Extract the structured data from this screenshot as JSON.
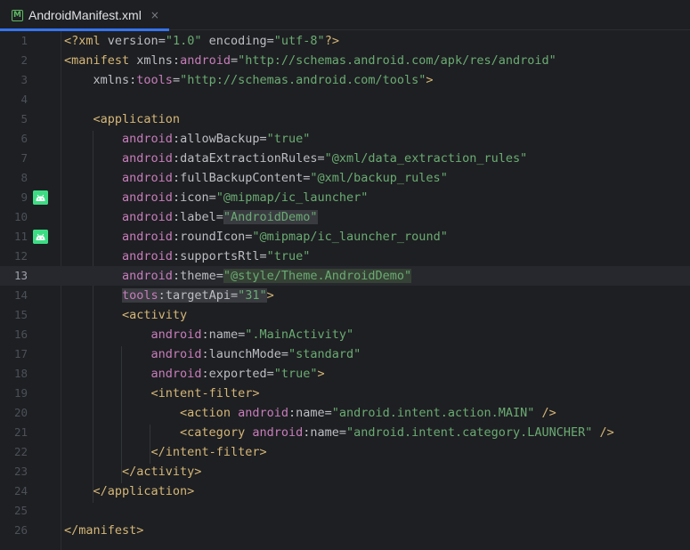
{
  "tab": {
    "title": "AndroidManifest.xml",
    "icon_glyph": "M",
    "close_glyph": "×"
  },
  "editor": {
    "current_line": 13,
    "lines": [
      {
        "n": "1",
        "tokens": [
          {
            "t": "<?xml ",
            "c": "t-tag"
          },
          {
            "t": "version",
            "c": "t-attr"
          },
          {
            "t": "=",
            "c": "t-txt"
          },
          {
            "t": "\"1.0\"",
            "c": "t-val"
          },
          {
            "t": " ",
            "c": "t-txt"
          },
          {
            "t": "encoding",
            "c": "t-attr"
          },
          {
            "t": "=",
            "c": "t-txt"
          },
          {
            "t": "\"utf-8\"",
            "c": "t-val"
          },
          {
            "t": "?>",
            "c": "t-tag"
          }
        ]
      },
      {
        "n": "2",
        "tokens": [
          {
            "t": "<manifest ",
            "c": "t-tag"
          },
          {
            "t": "xmlns",
            "c": "t-attr"
          },
          {
            "t": ":",
            "c": "t-txt"
          },
          {
            "t": "android",
            "c": "t-ns"
          },
          {
            "t": "=",
            "c": "t-txt"
          },
          {
            "t": "\"http://schemas.android.com/apk/res/android\"",
            "c": "t-val"
          }
        ]
      },
      {
        "n": "3",
        "tokens": [
          {
            "t": "    ",
            "c": "t-txt"
          },
          {
            "t": "xmlns",
            "c": "t-attr"
          },
          {
            "t": ":",
            "c": "t-txt"
          },
          {
            "t": "tools",
            "c": "t-ns"
          },
          {
            "t": "=",
            "c": "t-txt"
          },
          {
            "t": "\"http://schemas.android.com/tools\"",
            "c": "t-val"
          },
          {
            "t": ">",
            "c": "t-tag"
          }
        ]
      },
      {
        "n": "4",
        "tokens": []
      },
      {
        "n": "5",
        "tokens": [
          {
            "t": "    ",
            "c": "t-txt"
          },
          {
            "t": "<application",
            "c": "t-tag"
          }
        ]
      },
      {
        "n": "6",
        "tokens": [
          {
            "t": "        ",
            "c": "t-txt"
          },
          {
            "t": "android",
            "c": "t-ns"
          },
          {
            "t": ":",
            "c": "t-txt"
          },
          {
            "t": "allowBackup",
            "c": "t-attr"
          },
          {
            "t": "=",
            "c": "t-txt"
          },
          {
            "t": "\"true\"",
            "c": "t-val"
          }
        ]
      },
      {
        "n": "7",
        "tokens": [
          {
            "t": "        ",
            "c": "t-txt"
          },
          {
            "t": "android",
            "c": "t-ns"
          },
          {
            "t": ":",
            "c": "t-txt"
          },
          {
            "t": "dataExtractionRules",
            "c": "t-attr"
          },
          {
            "t": "=",
            "c": "t-txt"
          },
          {
            "t": "\"@xml/data_extraction_rules\"",
            "c": "t-val"
          }
        ]
      },
      {
        "n": "8",
        "tokens": [
          {
            "t": "        ",
            "c": "t-txt"
          },
          {
            "t": "android",
            "c": "t-ns"
          },
          {
            "t": ":",
            "c": "t-txt"
          },
          {
            "t": "fullBackupContent",
            "c": "t-attr"
          },
          {
            "t": "=",
            "c": "t-txt"
          },
          {
            "t": "\"@xml/backup_rules\"",
            "c": "t-val"
          }
        ]
      },
      {
        "n": "9",
        "icon": "android-icon",
        "tokens": [
          {
            "t": "        ",
            "c": "t-txt"
          },
          {
            "t": "android",
            "c": "t-ns"
          },
          {
            "t": ":",
            "c": "t-txt"
          },
          {
            "t": "icon",
            "c": "t-attr"
          },
          {
            "t": "=",
            "c": "t-txt"
          },
          {
            "t": "\"@mipmap/ic_launcher\"",
            "c": "t-val"
          }
        ]
      },
      {
        "n": "10",
        "tokens": [
          {
            "t": "        ",
            "c": "t-txt"
          },
          {
            "t": "android",
            "c": "t-ns"
          },
          {
            "t": ":",
            "c": "t-txt"
          },
          {
            "t": "label",
            "c": "t-attr"
          },
          {
            "t": "=",
            "c": "t-txt"
          },
          {
            "t": "\"AndroidDemo\"",
            "c": "t-val hl"
          }
        ]
      },
      {
        "n": "11",
        "icon": "android-icon",
        "tokens": [
          {
            "t": "        ",
            "c": "t-txt"
          },
          {
            "t": "android",
            "c": "t-ns"
          },
          {
            "t": ":",
            "c": "t-txt"
          },
          {
            "t": "roundIcon",
            "c": "t-attr"
          },
          {
            "t": "=",
            "c": "t-txt"
          },
          {
            "t": "\"@mipmap/ic_launcher_round\"",
            "c": "t-val"
          }
        ]
      },
      {
        "n": "12",
        "tokens": [
          {
            "t": "        ",
            "c": "t-txt"
          },
          {
            "t": "android",
            "c": "t-ns"
          },
          {
            "t": ":",
            "c": "t-txt"
          },
          {
            "t": "supportsRtl",
            "c": "t-attr"
          },
          {
            "t": "=",
            "c": "t-txt"
          },
          {
            "t": "\"true\"",
            "c": "t-val"
          }
        ]
      },
      {
        "n": "13",
        "tokens": [
          {
            "t": "        ",
            "c": "t-txt"
          },
          {
            "t": "android",
            "c": "t-ns"
          },
          {
            "t": ":",
            "c": "t-txt"
          },
          {
            "t": "theme",
            "c": "t-attr"
          },
          {
            "t": "=",
            "c": "t-txt"
          },
          {
            "t": "\"@style/Theme.AndroidDemo\"",
            "c": "t-val hl-match"
          }
        ]
      },
      {
        "n": "14",
        "tokens": [
          {
            "t": "        ",
            "c": "t-txt"
          },
          {
            "t": "tools",
            "c": "t-ns hl"
          },
          {
            "t": ":",
            "c": "t-txt hl"
          },
          {
            "t": "targetApi",
            "c": "t-attr hl"
          },
          {
            "t": "=",
            "c": "t-txt hl"
          },
          {
            "t": "\"31\"",
            "c": "t-val hl"
          },
          {
            "t": ">",
            "c": "t-tag"
          }
        ]
      },
      {
        "n": "15",
        "tokens": [
          {
            "t": "        ",
            "c": "t-txt"
          },
          {
            "t": "<activity",
            "c": "t-tag"
          }
        ]
      },
      {
        "n": "16",
        "tokens": [
          {
            "t": "            ",
            "c": "t-txt"
          },
          {
            "t": "android",
            "c": "t-ns"
          },
          {
            "t": ":",
            "c": "t-txt"
          },
          {
            "t": "name",
            "c": "t-attr"
          },
          {
            "t": "=",
            "c": "t-txt"
          },
          {
            "t": "\".MainActivity\"",
            "c": "t-val"
          }
        ]
      },
      {
        "n": "17",
        "tokens": [
          {
            "t": "            ",
            "c": "t-txt"
          },
          {
            "t": "android",
            "c": "t-ns"
          },
          {
            "t": ":",
            "c": "t-txt"
          },
          {
            "t": "launchMode",
            "c": "t-attr"
          },
          {
            "t": "=",
            "c": "t-txt"
          },
          {
            "t": "\"standard\"",
            "c": "t-val"
          }
        ]
      },
      {
        "n": "18",
        "tokens": [
          {
            "t": "            ",
            "c": "t-txt"
          },
          {
            "t": "android",
            "c": "t-ns"
          },
          {
            "t": ":",
            "c": "t-txt"
          },
          {
            "t": "exported",
            "c": "t-attr"
          },
          {
            "t": "=",
            "c": "t-txt"
          },
          {
            "t": "\"true\"",
            "c": "t-val"
          },
          {
            "t": ">",
            "c": "t-tag"
          }
        ]
      },
      {
        "n": "19",
        "tokens": [
          {
            "t": "            ",
            "c": "t-txt"
          },
          {
            "t": "<intent-filter>",
            "c": "t-tag"
          }
        ]
      },
      {
        "n": "20",
        "tokens": [
          {
            "t": "                ",
            "c": "t-txt"
          },
          {
            "t": "<action ",
            "c": "t-tag"
          },
          {
            "t": "android",
            "c": "t-ns"
          },
          {
            "t": ":",
            "c": "t-txt"
          },
          {
            "t": "name",
            "c": "t-attr"
          },
          {
            "t": "=",
            "c": "t-txt"
          },
          {
            "t": "\"android.intent.action.MAIN\"",
            "c": "t-val"
          },
          {
            "t": " />",
            "c": "t-tag"
          }
        ]
      },
      {
        "n": "21",
        "tokens": [
          {
            "t": "                ",
            "c": "t-txt"
          },
          {
            "t": "<category ",
            "c": "t-tag"
          },
          {
            "t": "android",
            "c": "t-ns"
          },
          {
            "t": ":",
            "c": "t-txt"
          },
          {
            "t": "name",
            "c": "t-attr"
          },
          {
            "t": "=",
            "c": "t-txt"
          },
          {
            "t": "\"android.intent.category.LAUNCHER\"",
            "c": "t-val"
          },
          {
            "t": " />",
            "c": "t-tag"
          }
        ]
      },
      {
        "n": "22",
        "tokens": [
          {
            "t": "            ",
            "c": "t-txt"
          },
          {
            "t": "</intent-filter>",
            "c": "t-tag"
          }
        ]
      },
      {
        "n": "23",
        "tokens": [
          {
            "t": "        ",
            "c": "t-txt"
          },
          {
            "t": "</activity>",
            "c": "t-tag"
          }
        ]
      },
      {
        "n": "24",
        "tokens": [
          {
            "t": "    ",
            "c": "t-txt"
          },
          {
            "t": "</application>",
            "c": "t-tag"
          }
        ]
      },
      {
        "n": "25",
        "tokens": []
      },
      {
        "n": "26",
        "tokens": [
          {
            "t": "</manifest>",
            "c": "t-tag"
          }
        ]
      }
    ]
  },
  "colors": {
    "background": "#1e1f22",
    "tag": "#d5b778",
    "namespace": "#c77dbb",
    "attribute": "#bcbec4",
    "value": "#6aab73",
    "accent": "#3574f0",
    "android_green": "#3ddc84"
  }
}
